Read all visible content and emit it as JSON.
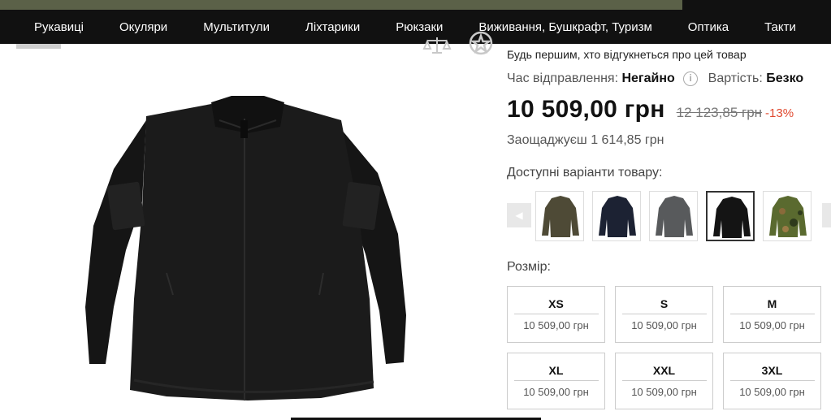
{
  "nav": {
    "items": [
      {
        "label": "Рукавиці"
      },
      {
        "label": "Окуляри"
      },
      {
        "label": "Мультитули"
      },
      {
        "label": "Ліхтарики"
      },
      {
        "label": "Рюкзаки"
      },
      {
        "label": "Виживання, Бушкрафт, Туризм"
      },
      {
        "label": "Оптика"
      },
      {
        "label": "Такти"
      }
    ]
  },
  "toolbar_icons": {
    "scale": "scale-icon",
    "compare": "compare-icon"
  },
  "product": {
    "review_prompt": "Будь першим, хто відгукнеться про цей товар",
    "shipping_label": "Час відправлення:",
    "shipping_value": "Негайно",
    "cost_label": "Вартість:",
    "cost_value": "Безко",
    "price": "10 509,00 грн",
    "old_price": "12 123,85 грн",
    "discount": "-13%",
    "saving": "Заощаджуєш 1 614,85 грн",
    "variants_label": "Доступні варіанти товару:",
    "variants": [
      {
        "name": "olive",
        "color": "#4e4a36"
      },
      {
        "name": "navy",
        "color": "#1c2233"
      },
      {
        "name": "grey",
        "color": "#585a5c"
      },
      {
        "name": "black",
        "color": "#141414",
        "selected": true
      },
      {
        "name": "camo",
        "color": "#5a6a2f"
      }
    ],
    "size_label": "Розмір:",
    "sizes": [
      {
        "size": "XS",
        "price": "10 509,00 грн"
      },
      {
        "size": "S",
        "price": "10 509,00 грн"
      },
      {
        "size": "M",
        "price": "10 509,00 грн"
      },
      {
        "size": "XL",
        "price": "10 509,00 грн"
      },
      {
        "size": "XXL",
        "price": "10 509,00 грн"
      },
      {
        "size": "3XL",
        "price": "10 509,00 грн"
      }
    ]
  },
  "colors": {
    "accent_discount": "#e0482e",
    "nav_bg": "#111111",
    "top_strip": "#5b6148"
  }
}
